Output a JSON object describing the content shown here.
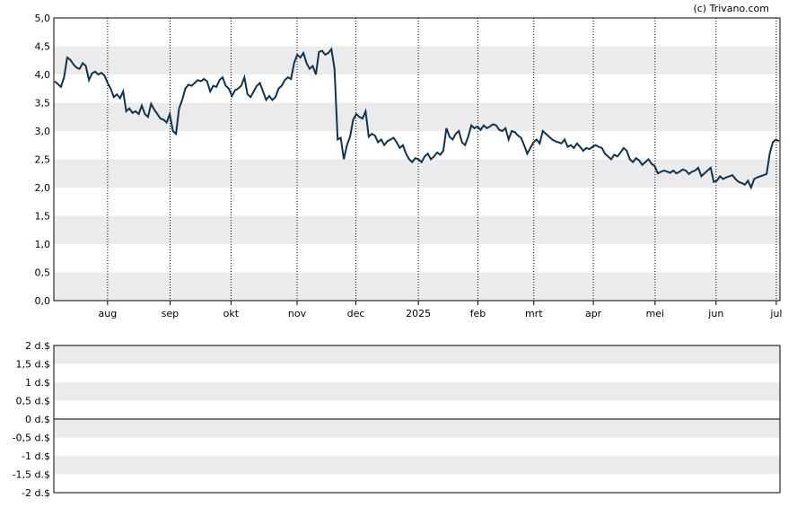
{
  "credit": "(c) Trivano.com",
  "colors": {
    "line": "#0d3551",
    "band": "#ebebeb",
    "background": "#ffffff",
    "axis": "#000000",
    "gridline": "#000000"
  },
  "chart_data": [
    {
      "type": "line",
      "name": "price",
      "ylim": [
        0,
        5
      ],
      "y_ticks": [
        "0,0",
        "0,5",
        "1,0",
        "1,5",
        "2,0",
        "2,5",
        "3,0",
        "3,5",
        "4,0",
        "4,5",
        "5,0"
      ],
      "x_tick_labels": [
        "aug",
        "sep",
        "okt",
        "nov",
        "dec",
        "2025",
        "feb",
        "mrt",
        "apr",
        "mei",
        "jun",
        "jul"
      ],
      "grid": "vertical dotted lines at month starts, alternating horizontal bands",
      "series": [
        {
          "values": [
            3.88,
            3.83,
            3.78,
            3.95,
            4.3,
            4.26,
            4.18,
            4.12,
            4.1,
            4.2,
            4.15,
            3.9,
            4.02,
            4.05,
            4.0,
            4.03,
            3.98,
            3.85,
            3.75,
            3.6,
            3.65,
            3.58,
            3.7,
            3.35,
            3.4,
            3.32,
            3.35,
            3.3,
            3.45,
            3.3,
            3.25,
            3.48,
            3.38,
            3.3,
            3.22,
            3.2,
            3.15,
            3.3,
            3.0,
            2.95,
            3.4,
            3.55,
            3.75,
            3.82,
            3.8,
            3.85,
            3.9,
            3.88,
            3.92,
            3.88,
            3.7,
            3.8,
            3.78,
            3.9,
            3.95,
            3.8,
            3.75,
            3.62,
            3.72,
            3.75,
            3.8,
            3.95,
            3.65,
            3.6,
            3.7,
            3.8,
            3.85,
            3.7,
            3.55,
            3.62,
            3.55,
            3.6,
            3.75,
            3.8,
            3.9,
            3.95,
            3.92,
            4.2,
            4.35,
            4.3,
            4.38,
            4.2,
            4.1,
            4.15,
            4.0,
            4.4,
            4.42,
            4.35,
            4.38,
            4.45,
            4.1,
            2.85,
            2.88,
            2.5,
            2.75,
            2.9,
            3.2,
            3.3,
            3.25,
            3.22,
            3.35,
            2.9,
            2.95,
            2.92,
            2.8,
            2.85,
            2.75,
            2.82,
            2.85,
            2.88,
            2.8,
            2.7,
            2.75,
            2.6,
            2.5,
            2.45,
            2.52,
            2.5,
            2.45,
            2.55,
            2.6,
            2.5,
            2.55,
            2.62,
            2.58,
            2.65,
            3.05,
            2.9,
            2.85,
            2.95,
            3.0,
            2.8,
            2.75,
            2.9,
            3.1,
            3.05,
            3.08,
            3.02,
            3.1,
            3.05,
            3.08,
            3.12,
            3.1,
            3.02,
            3.0,
            3.05,
            2.85,
            3.0,
            2.98,
            2.92,
            2.88,
            2.75,
            2.6,
            2.7,
            2.8,
            2.85,
            2.78,
            3.0,
            2.95,
            2.9,
            2.85,
            2.82,
            2.8,
            2.78,
            2.85,
            2.72,
            2.75,
            2.7,
            2.78,
            2.72,
            2.65,
            2.7,
            2.68,
            2.72,
            2.75,
            2.72,
            2.7,
            2.6,
            2.55,
            2.5,
            2.58,
            2.55,
            2.62,
            2.7,
            2.65,
            2.5,
            2.45,
            2.52,
            2.48,
            2.4,
            2.45,
            2.5,
            2.42,
            2.38,
            2.25,
            2.28,
            2.3,
            2.28,
            2.26,
            2.3,
            2.25,
            2.28,
            2.32,
            2.3,
            2.24,
            2.28,
            2.3,
            2.35,
            2.2,
            2.25,
            2.3,
            2.35,
            2.1,
            2.12,
            2.2,
            2.15,
            2.18,
            2.2,
            2.22,
            2.15,
            2.1,
            2.08,
            2.05,
            2.12,
            2.0,
            2.15,
            2.18,
            2.2,
            2.22,
            2.24,
            2.6,
            2.8,
            2.85,
            2.82
          ]
        }
      ]
    },
    {
      "type": "bar",
      "name": "dividend",
      "ylim": [
        -2,
        2
      ],
      "y_ticks": [
        "2 d.$",
        "1,5 d.$",
        "1 d.$",
        "0,5 d.$",
        "0 d.$",
        "-0,5 d.$",
        "-1 d.$",
        "-1,5 d.$",
        "-2 d.$"
      ],
      "values": []
    }
  ]
}
